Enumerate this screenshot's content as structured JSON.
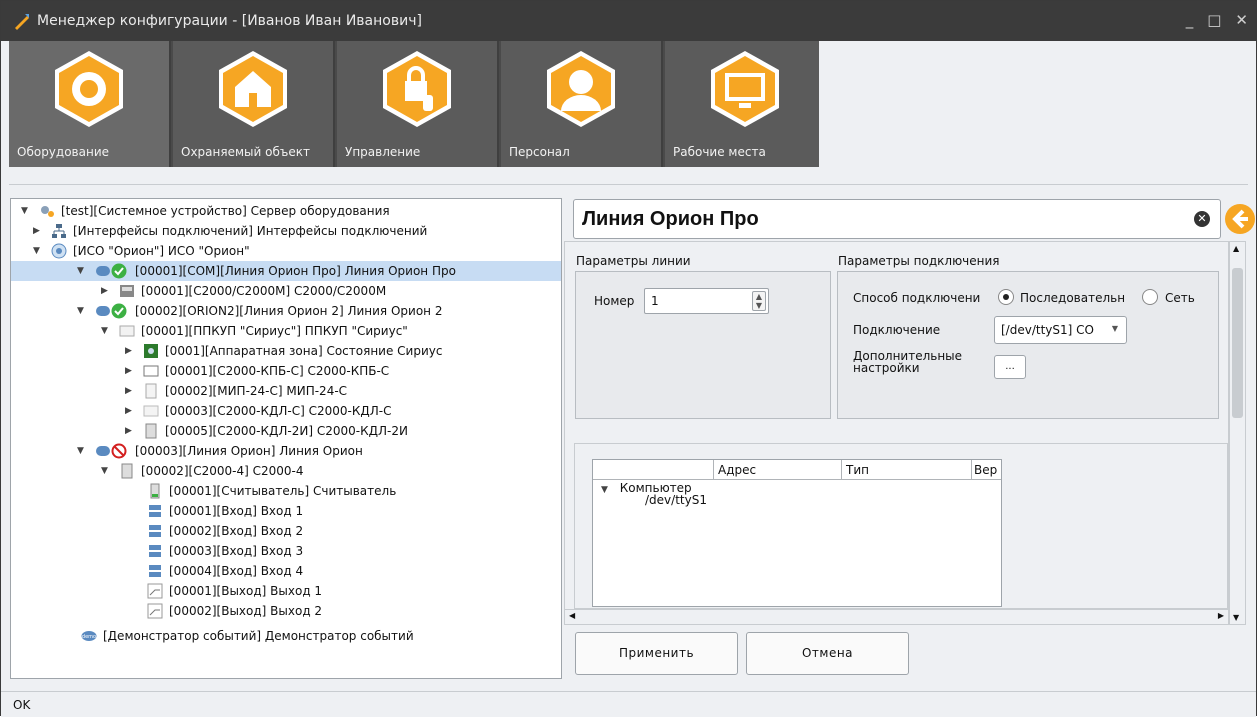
{
  "window": {
    "title": "Менеджер конфигурации - [Иванов Иван Иванович]",
    "minimize_glyph": "_",
    "maximize_glyph": "□",
    "close_glyph": "✕"
  },
  "toolbar": {
    "items": [
      {
        "label": "Оборудование",
        "icon": "gear-icon"
      },
      {
        "label": "Охраняемый объект",
        "icon": "house-icon"
      },
      {
        "label": "Управление",
        "icon": "lock-hand-icon"
      },
      {
        "label": "Персонал",
        "icon": "person-icon"
      },
      {
        "label": "Рабочие места",
        "icon": "monitor-icon"
      }
    ],
    "accent_color": "#f6a623"
  },
  "tree": {
    "nodes": [
      {
        "text": "[test][Системное устройство] Сервер оборудования",
        "arrow": "▼",
        "icon": "gears-icon"
      },
      {
        "text": "[Интерфейсы подключений] Интерфейсы подключений",
        "arrow": "▶",
        "icon": "network-icon"
      },
      {
        "text": "[ИСО \"Орион\"] ИСО \"Орион\"",
        "arrow": "▼",
        "icon": "orion-icon"
      },
      {
        "text": "[00001][COM][Линия Орион Про] Линия Орион Про",
        "arrow": "▼",
        "icon": "line-ok-icon"
      },
      {
        "text": "[00001][С2000/С2000М] С2000/С2000М",
        "arrow": "▶",
        "icon": "panel-icon"
      },
      {
        "text": "[00002][ORION2][Линия Орион 2] Линия Орион 2",
        "arrow": "▼",
        "icon": "line-ok-icon"
      },
      {
        "text": "[00001][ППКУП \"Сириус\"] ППКУП \"Сириус\"",
        "arrow": "▼",
        "icon": "device-icon"
      },
      {
        "text": "[0001][Аппаратная зона] Состояние Сириус",
        "arrow": "▶",
        "icon": "zone-icon"
      },
      {
        "text": "[00001][С2000-КПБ-С] С2000-КПБ-С",
        "arrow": "▶",
        "icon": "device-icon"
      },
      {
        "text": "[00002][МИП-24-С] МИП-24-С",
        "arrow": "▶",
        "icon": "device-icon"
      },
      {
        "text": "[00003][С2000-КДЛ-С] С2000-КДЛ-С",
        "arrow": "▶",
        "icon": "device-icon"
      },
      {
        "text": "[00005][С2000-КДЛ-2И] С2000-КДЛ-2И",
        "arrow": "▶",
        "icon": "device-icon"
      },
      {
        "text": "[00003][Линия Орион] Линия Орион",
        "arrow": "▼",
        "icon": "line-off-icon"
      },
      {
        "text": "[00002][С2000-4] С2000-4",
        "arrow": "▼",
        "icon": "device-icon"
      },
      {
        "text": "[00001][Считыватель] Считыватель",
        "arrow": "",
        "icon": "reader-icon"
      },
      {
        "text": "[00001][Вход] Вход 1",
        "arrow": "",
        "icon": "input-icon"
      },
      {
        "text": "[00002][Вход] Вход 2",
        "arrow": "",
        "icon": "input-icon"
      },
      {
        "text": "[00003][Вход] Вход 3",
        "arrow": "",
        "icon": "input-icon"
      },
      {
        "text": "[00004][Вход] Вход 4",
        "arrow": "",
        "icon": "input-icon"
      },
      {
        "text": "[00001][Выход] Выход 1",
        "arrow": "",
        "icon": "output-icon"
      },
      {
        "text": "[00002][Выход] Выход 2",
        "arrow": "",
        "icon": "output-icon"
      },
      {
        "text": "[Демонстратор событий] Демонстратор событий",
        "arrow": "",
        "icon": "demo-icon"
      }
    ]
  },
  "detail": {
    "title": "Линия Орион Про",
    "line_params": {
      "group_title": "Параметры линии",
      "number_label": "Номер",
      "number_value": "1"
    },
    "connection_params": {
      "group_title": "Параметры подключения",
      "method_label": "Способ подключени",
      "option_serial": "Последовательн",
      "option_network": "Сеть",
      "connection_label": "Подключение",
      "connection_value": "[/dev/ttyS1] CO",
      "advanced_label_1": "Дополнительные",
      "advanced_label_2": "настройки",
      "advanced_button": "..."
    },
    "grid": {
      "columns": [
        "Адрес",
        "Тип",
        "Вер"
      ],
      "rows": [
        {
          "text": "Компьютер",
          "arrow": "▼"
        },
        {
          "text": "/dev/ttyS1",
          "arrow": ""
        }
      ]
    },
    "apply_button": "Применить",
    "cancel_button": "Отмена"
  },
  "status": {
    "text": "OK"
  }
}
